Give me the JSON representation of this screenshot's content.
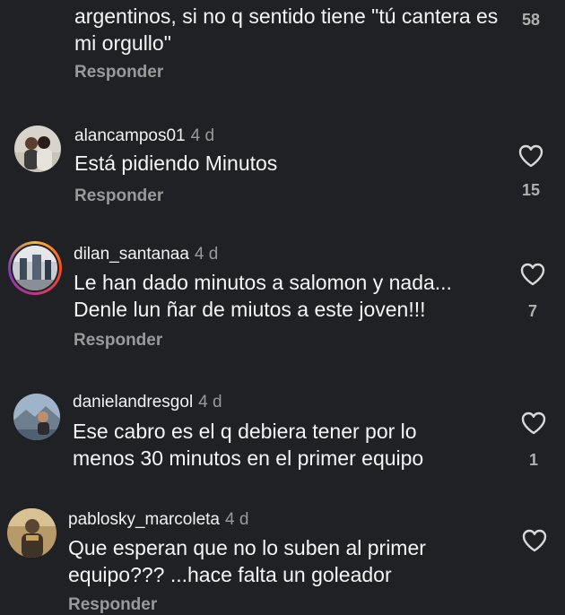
{
  "comments": [
    {
      "text": "argentinos, si no q sentido tiene \"tú cantera es mi orgullo\"",
      "reply_label": "Responder",
      "likes": "58"
    },
    {
      "username": "alancampos01",
      "time": "4 d",
      "text": "Está pidiendo Minutos",
      "reply_label": "Responder",
      "likes": "15"
    },
    {
      "username": "dilan_santanaa",
      "time": "4 d",
      "text": "Le han dado minutos a salomon y nada... Denle lun ñar de miutos a este joven!!!",
      "reply_label": "Responder",
      "likes": "7"
    },
    {
      "username": "danielandresgol",
      "time": "4 d",
      "text": "Ese cabro es el q debiera tener por lo menos 30 minutos en el primer equipo",
      "likes": "1"
    },
    {
      "username": "pablosky_marcoleta",
      "time": "4 d",
      "text": "Que esperan que no lo suben al primer equipo??? ...hace falta un goleador",
      "reply_label": "Responder"
    }
  ],
  "icons": {
    "like": "heart-outline-icon"
  },
  "colors": {
    "background": "#202124",
    "secondary_text": "#9a9a9a",
    "story_ring": "#c13584"
  }
}
